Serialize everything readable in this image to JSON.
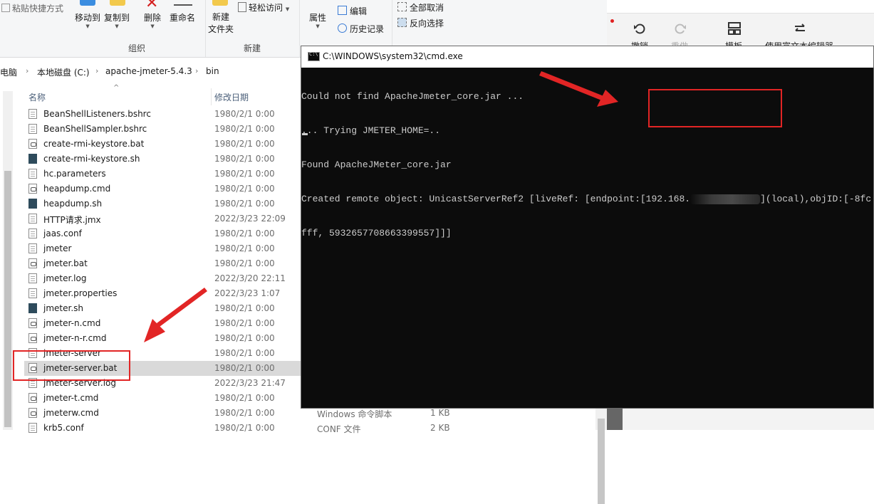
{
  "ribbon": {
    "paste_shortcut": "粘贴快捷方式",
    "move_to": "移动到",
    "copy_to": "复制到",
    "delete": "删除",
    "rename": "重命名",
    "group_organize": "组织",
    "new_folder_l1": "新建",
    "new_folder_l2": "文件夹",
    "easy_access": "轻松访问",
    "group_new": "新建",
    "properties": "属性",
    "edit": "编辑",
    "history": "历史记录",
    "select_none": "全部取消",
    "invert_selection": "反向选择"
  },
  "address": {
    "crumbs": [
      "电脑",
      "本地磁盘 (C:)",
      "apache-jmeter-5.4.3",
      "bin"
    ]
  },
  "columns": {
    "name": "名称",
    "modified": "修改日期"
  },
  "files": [
    {
      "name": "BeanShellListeners.bshrc",
      "date": "1980/2/1 0:00",
      "icon": "txt"
    },
    {
      "name": "BeanShellSampler.bshrc",
      "date": "1980/2/1 0:00",
      "icon": "txt"
    },
    {
      "name": "create-rmi-keystore.bat",
      "date": "1980/2/1 0:00",
      "icon": "cmd"
    },
    {
      "name": "create-rmi-keystore.sh",
      "date": "1980/2/1 0:00",
      "icon": "sh"
    },
    {
      "name": "hc.parameters",
      "date": "1980/2/1 0:00",
      "icon": "txt"
    },
    {
      "name": "heapdump.cmd",
      "date": "1980/2/1 0:00",
      "icon": "cmd"
    },
    {
      "name": "heapdump.sh",
      "date": "1980/2/1 0:00",
      "icon": "sh"
    },
    {
      "name": "HTTP请求.jmx",
      "date": "2022/3/23 22:09",
      "icon": "txt"
    },
    {
      "name": "jaas.conf",
      "date": "1980/2/1 0:00",
      "icon": "txt"
    },
    {
      "name": "jmeter",
      "date": "1980/2/1 0:00",
      "icon": "txt"
    },
    {
      "name": "jmeter.bat",
      "date": "1980/2/1 0:00",
      "icon": "cmd"
    },
    {
      "name": "jmeter.log",
      "date": "2022/3/20 22:11",
      "icon": "txt"
    },
    {
      "name": "jmeter.properties",
      "date": "2022/3/23 1:07",
      "icon": "txt"
    },
    {
      "name": "jmeter.sh",
      "date": "1980/2/1 0:00",
      "icon": "sh"
    },
    {
      "name": "jmeter-n.cmd",
      "date": "1980/2/1 0:00",
      "icon": "cmd"
    },
    {
      "name": "jmeter-n-r.cmd",
      "date": "1980/2/1 0:00",
      "icon": "cmd"
    },
    {
      "name": "jmeter-server",
      "date": "1980/2/1 0:00",
      "icon": "txt"
    },
    {
      "name": "jmeter-server.bat",
      "date": "1980/2/1 0:00",
      "icon": "cmd",
      "selected": true
    },
    {
      "name": "jmeter-server.log",
      "date": "2022/3/23 21:47",
      "icon": "txt"
    },
    {
      "name": "jmeter-t.cmd",
      "date": "1980/2/1 0:00",
      "icon": "cmd"
    },
    {
      "name": "jmeterw.cmd",
      "date": "1980/2/1 0:00",
      "icon": "cmd",
      "type": "Windows 命令脚本",
      "size": "1 KB"
    },
    {
      "name": "krb5.conf",
      "date": "1980/2/1 0:00",
      "icon": "txt",
      "type": "CONF 文件",
      "size": "2 KB"
    }
  ],
  "cmd": {
    "title": "C:\\WINDOWS\\system32\\cmd.exe",
    "lines": [
      "Could not find ApacheJmeter_core.jar ...",
      "... Trying JMETER_HOME=..",
      "Found ApacheJMeter_core.jar"
    ],
    "line4_prefix": "Created remote object: UnicastServerRef2 [liveRef: [endpoint:[192.168.",
    "line4_suffix": "](local),objID:[-8fc",
    "line5": "fff, 5932657708663399557]]]"
  },
  "editor": {
    "undo": "撤销",
    "redo": "重做",
    "template": "模板",
    "rich_text": "使用富文本编辑器"
  },
  "colors": {
    "annotation_red": "#e22525",
    "terminal_bg": "#0c0c0c",
    "terminal_fg": "#cccccc",
    "selected_row": "#d9d9d9"
  }
}
